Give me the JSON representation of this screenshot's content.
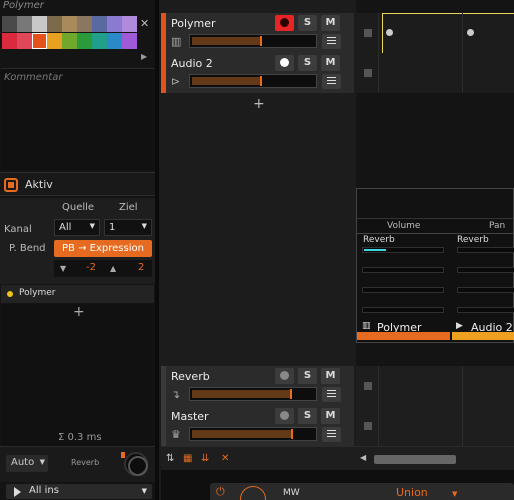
{
  "left_panel": {
    "title": "Polymer",
    "close_symbol": "✕",
    "palette_arrow": "▶",
    "comment_placeholder": "Kommentar",
    "aktiv_label": "Aktiv",
    "modulation": {
      "col_source": "Quelle",
      "col_target": "Ziel",
      "row_channel": "Kanal",
      "row_pbend": "P. Bend",
      "source_value": "All",
      "target_value": "1",
      "pb_button": "PB → Expression",
      "range_min": "-2",
      "range_max": "2",
      "down_arrow": "▼",
      "up_arrow": "▲"
    },
    "device_name": "Polymer",
    "plus": "+",
    "latency": "Σ 0.3 ms",
    "automation_mode": "Auto",
    "send_label": "Reverb",
    "input_select": "All ins"
  },
  "tracks": [
    {
      "name": "Polymer",
      "color": "#e4521b",
      "s_label": "S",
      "m_label": "M",
      "meter_level": 0.54
    },
    {
      "name": "Audio 2",
      "color": "#e4521b",
      "s_label": "S",
      "m_label": "M",
      "meter_level": 0.54
    },
    {
      "name": "Reverb",
      "color": "#2b2b2b",
      "s_label": "S",
      "m_label": "M",
      "meter_level": 0.78
    },
    {
      "name": "Master",
      "color": "#2b2b2b",
      "s_label": "S",
      "m_label": "M",
      "meter_level": 0.8
    }
  ],
  "add_track": "+",
  "mixer": {
    "col_volume": "Volume",
    "col_pan": "Pan",
    "send1": "Reverb",
    "send2": "Reverb",
    "ch1_name": "Polymer",
    "ch2_name": "Audio 2",
    "ch1_color": "#e66a1f",
    "ch2_color": "#f0a020"
  },
  "bottom_bar": {
    "power": "⏻",
    "mw_label": "MW",
    "preset_name": "Union"
  },
  "colors": {
    "accent": "#e66a1f",
    "record": "#e82424",
    "send_meter": "#3fd7e0"
  }
}
